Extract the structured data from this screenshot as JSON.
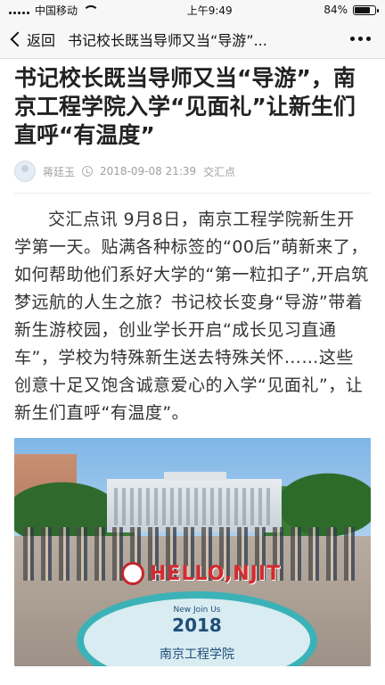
{
  "status_bar": {
    "carrier": "中国移动",
    "time": "上午9:49",
    "battery": "84%",
    "battery_level": 0.84
  },
  "nav": {
    "back_label": "返回",
    "title": "书记校长既当导师又当“导游”...",
    "back_icon": "chevron-left-icon",
    "more_icon": "ellipsis-icon"
  },
  "article": {
    "title": "书记校长既当导师又当“导游”，南京工程学院入学“见面礼”让新生们直呼“有温度”",
    "author": "蒋廷玉",
    "date": "2018-09-08 21:39",
    "source": "交汇点",
    "body": "交汇点讯  9月8日，南京工程学院新生开学第一天。贴满各种标签的“00后”萌新来了，如何帮助他们系好大学的“第一粒扣子”,开启筑梦远航的人生之旅？书记校长变身“导游”带着新生游校园，创业学长开启“成长见习直通车”，学校为特殊新生送去特殊关怀……这些创意十足又饱含诚意爱心的入学“见面礼”，让新生们直呼“有温度”。"
  },
  "photo": {
    "sign_text": "HELLO,NJIT",
    "floor_tagline": "New Join Us",
    "floor_year": "2018",
    "floor_school": "南京工程学院"
  }
}
